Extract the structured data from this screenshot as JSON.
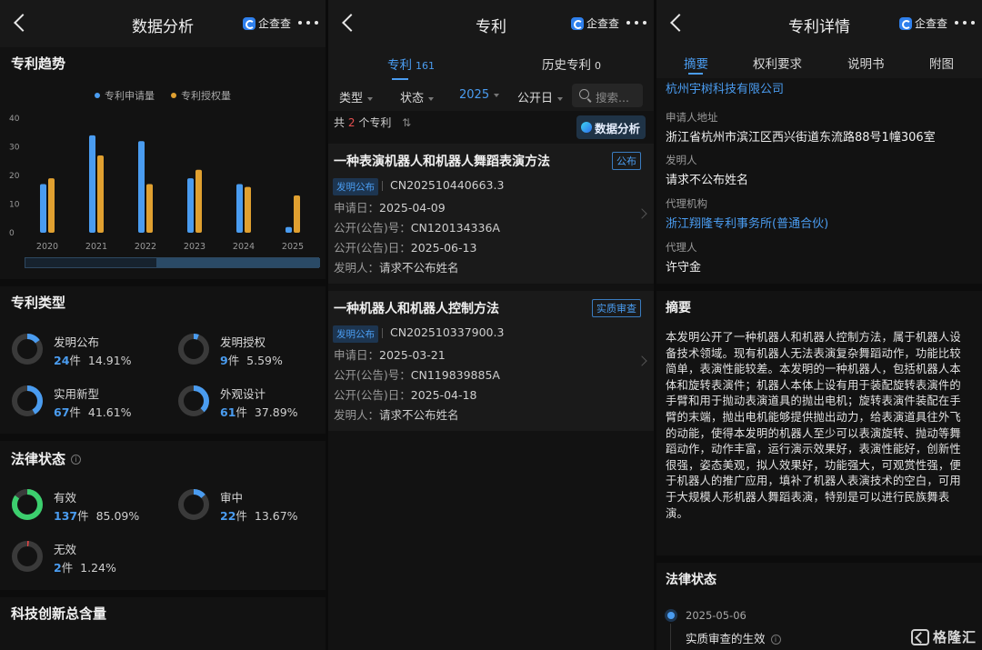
{
  "panel1": {
    "title": "数据分析",
    "brand": "企查查",
    "trend": {
      "title": "专利趋势",
      "legend": [
        "专利申请量",
        "专利授权量"
      ]
    },
    "types": {
      "title": "专利类型",
      "items": [
        {
          "label": "发明公布",
          "count": "24",
          "unit": "件",
          "pct": "14.91%",
          "fraction": 0.1491
        },
        {
          "label": "发明授权",
          "count": "9",
          "unit": "件",
          "pct": "5.59%",
          "fraction": 0.0559
        },
        {
          "label": "实用新型",
          "count": "67",
          "unit": "件",
          "pct": "41.61%",
          "fraction": 0.4161
        },
        {
          "label": "外观设计",
          "count": "61",
          "unit": "件",
          "pct": "37.89%",
          "fraction": 0.3789
        }
      ]
    },
    "legal": {
      "title": "法律状态",
      "info": "i",
      "items": [
        {
          "label": "有效",
          "count": "137",
          "unit": "件",
          "pct": "85.09%",
          "fraction": 0.8509
        },
        {
          "label": "审中",
          "count": "22",
          "unit": "件",
          "pct": "13.67%",
          "fraction": 0.1367
        },
        {
          "label": "无效",
          "count": "2",
          "unit": "件",
          "pct": "1.24%",
          "fraction": 0.0124
        }
      ]
    },
    "innovation_title": "科技创新总含量"
  },
  "chart_data": {
    "type": "bar",
    "categories": [
      "2020",
      "2021",
      "2022",
      "2023",
      "2024",
      "2025"
    ],
    "series": [
      {
        "name": "专利申请量",
        "values": [
          17,
          34,
          32,
          19,
          17,
          2
        ]
      },
      {
        "name": "专利授权量",
        "values": [
          19,
          27,
          17,
          22,
          16,
          13
        ]
      }
    ],
    "yticks": [
      "0",
      "10",
      "20",
      "30",
      "40"
    ],
    "ylim": [
      0,
      40
    ],
    "colors": [
      "#4a9cf0",
      "#e0a030"
    ],
    "legend_position": "top-center",
    "grid": false
  },
  "panel2": {
    "title": "专利",
    "brand": "企查查",
    "tabs": [
      {
        "label": "专利",
        "count": "161"
      },
      {
        "label": "历史专利",
        "count": "0"
      }
    ],
    "filters": [
      "类型",
      "状态",
      "2025",
      "公开日"
    ],
    "search_placeholder": "搜索...",
    "count_prefix": "共",
    "count": "2",
    "count_suffix": "个专利",
    "sort_icon": "⇅",
    "analysis_button": "数据分析",
    "patents": [
      {
        "title": "一种表演机器人和机器人舞蹈表演方法",
        "status": "公布",
        "type": "发明公布",
        "app_no": "CN202510440663.3",
        "apply_date_label": "申请日：",
        "apply_date": "2025-04-09",
        "pub_no_label": "公开(公告)号：",
        "pub_no": "CN120134336A",
        "pub_date_label": "公开(公告)日：",
        "pub_date": "2025-06-13",
        "inventor_label": "发明人：",
        "inventor": "请求不公布姓名"
      },
      {
        "title": "一种机器人和机器人控制方法",
        "status": "实质审查",
        "type": "发明公布",
        "app_no": "CN202510337900.3",
        "apply_date_label": "申请日：",
        "apply_date": "2025-03-21",
        "pub_no_label": "公开(公告)号：",
        "pub_no": "CN119839885A",
        "pub_date_label": "公开(公告)日：",
        "pub_date": "2025-04-18",
        "inventor_label": "发明人：",
        "inventor": "请求不公布姓名"
      }
    ]
  },
  "panel3": {
    "title": "专利详情",
    "brand": "企查查",
    "tabs": [
      "摘要",
      "权利要求",
      "说明书",
      "附图"
    ],
    "applicant": "杭州宇树科技有限公司",
    "address_label": "申请人地址",
    "address": "浙江省杭州市滨江区西兴街道东流路88号1幢306室",
    "inventor_label": "发明人",
    "inventor": "请求不公布姓名",
    "agency_label": "代理机构",
    "agency": "浙江翔隆专利事务所(普通合伙)",
    "agent_label": "代理人",
    "agent": "许守金",
    "abstract_title": "摘要",
    "abstract": "本发明公开了一种机器人和机器人控制方法，属于机器人设备技术领域。现有机器人无法表演复杂舞蹈动作，功能比较简单，表演性能较差。本发明的一种机器人，包括机器人本体和旋转表演件；机器人本体上设有用于装配旋转表演件的手臂和用于抛动表演道具的抛出电机；旋转表演件装配在手臂的末端，抛出电机能够提供抛出动力，给表演道具往外飞的动能，使得本发明的机器人至少可以表演旋转、抛动等舞蹈动作，动作丰富，运行演示效果好，表演性能好，创新性很强，姿态美观，拟人效果好，功能强大，可观赏性强，便于机器人的推广应用，填补了机器人表演技术的空白，可用于大规模人形机器人舞蹈表演，特别是可以进行民族舞表演。",
    "legal_title": "法律状态",
    "legal_date": "2025-05-06",
    "legal_event": "实质审查的生效",
    "watermark": "格隆汇"
  }
}
